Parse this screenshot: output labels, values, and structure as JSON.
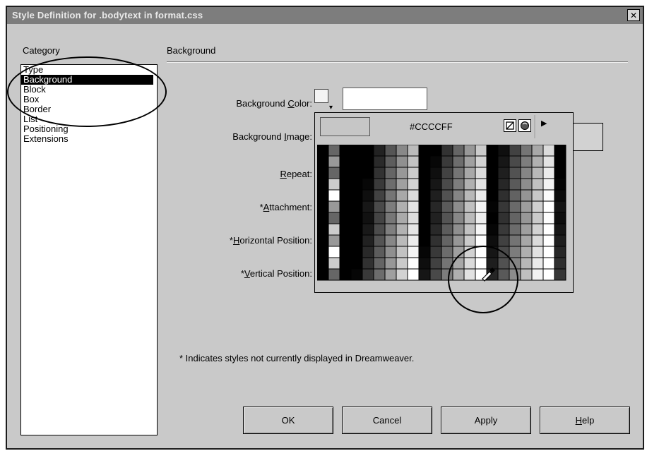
{
  "window": {
    "title": "Style Definition for .bodytext in format.css",
    "close_symbol": "✕"
  },
  "category": {
    "label": "Category",
    "items": [
      "Type",
      "Background",
      "Block",
      "Box",
      "Border",
      "List",
      "Positioning",
      "Extensions"
    ],
    "selected": "Background"
  },
  "section": {
    "title": "Background"
  },
  "fields": {
    "bg_color_pre": "Background ",
    "bg_color_key": "C",
    "bg_color_post": "olor:",
    "bg_image_pre": "Background ",
    "bg_image_key": "I",
    "bg_image_post": "mage:",
    "repeat_key": "R",
    "repeat_post": "epeat:",
    "attachment_pre": "*",
    "attachment_key": "A",
    "attachment_post": "ttachment:",
    "hpos_pre": "*",
    "hpos_key": "H",
    "hpos_post": "orizontal Position:",
    "vpos_pre": "*",
    "vpos_key": "V",
    "vpos_post": "ertical Position:"
  },
  "palette": {
    "hex_value": "#CCCCFF",
    "icons": [
      "no-color-icon",
      "system-color-picker-icon",
      "palette-menu-arrow-icon",
      "eyedropper-icon"
    ]
  },
  "note": "* Indicates styles not currently displayed in Dreamweaver.",
  "buttons": {
    "ok": "OK",
    "cancel": "Cancel",
    "apply": "Apply",
    "help_key": "H",
    "help_rest": "elp"
  },
  "colors": {
    "dialog_bg": "#c9c9c9",
    "titlebar": "#7d7d7d",
    "selection": "#000000"
  }
}
